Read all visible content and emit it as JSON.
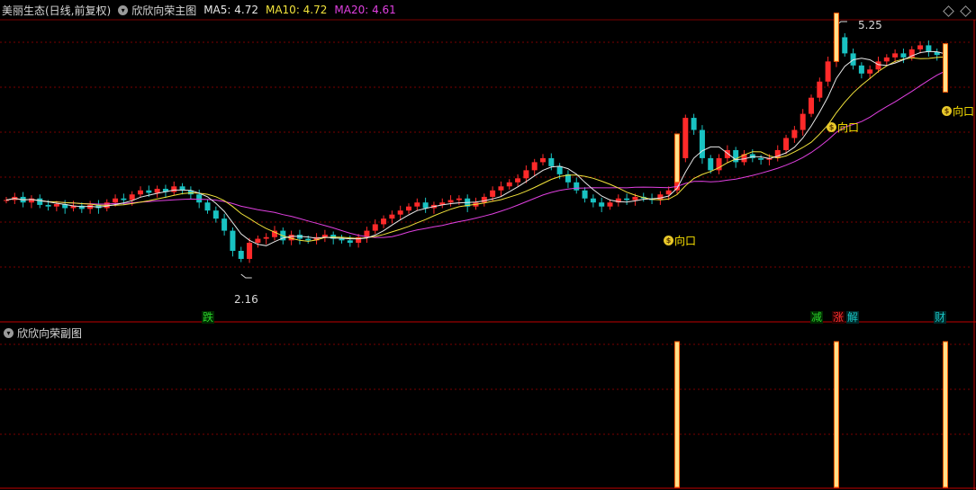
{
  "header": {
    "stock_title": "美丽生态(日线,前复权)",
    "indicator_name": "欣欣向荣主图",
    "ma5_label": "MA5: 4.72",
    "ma10_label": "MA10: 4.72",
    "ma20_label": "MA20: 4.61"
  },
  "sub_panel": {
    "title": "欣欣向荣副图"
  },
  "annotations": {
    "high_label": "5.25",
    "low_label": "2.16"
  },
  "signals": [
    "跌",
    "减",
    "涨",
    "解",
    "财"
  ],
  "money_label": "向口",
  "colors": {
    "up": "#ff2a2a",
    "down": "#19c2c2",
    "ma5": "#e8e8e8",
    "ma10": "#f2e33b",
    "ma20": "#e040e0",
    "grid": "#7a0000",
    "signal_bar": "#ffe08a"
  },
  "chart_data": {
    "type": "candlestick",
    "title": "欣欣向荣主图",
    "price_high": 5.25,
    "price_low": 2.16,
    "ma_latest": {
      "MA5": 4.72,
      "MA10": 4.72,
      "MA20": 4.61
    },
    "closes": [
      3.08,
      3.12,
      3.05,
      3.1,
      3.02,
      3.0,
      3.03,
      2.98,
      3.01,
      2.97,
      3.02,
      2.98,
      3.05,
      3.1,
      3.08,
      3.15,
      3.2,
      3.17,
      3.22,
      3.18,
      3.25,
      3.2,
      3.15,
      3.05,
      2.95,
      2.85,
      2.7,
      2.45,
      2.35,
      2.55,
      2.6,
      2.62,
      2.7,
      2.58,
      2.65,
      2.6,
      2.58,
      2.62,
      2.65,
      2.6,
      2.58,
      2.55,
      2.62,
      2.7,
      2.78,
      2.85,
      2.9,
      2.95,
      3.0,
      3.05,
      2.98,
      3.02,
      3.05,
      3.08,
      3.1,
      3.0,
      3.05,
      3.12,
      3.2,
      3.25,
      3.3,
      3.35,
      3.45,
      3.55,
      3.6,
      3.5,
      3.4,
      3.3,
      3.2,
      3.1,
      3.05,
      3.0,
      3.05,
      3.1,
      3.08,
      3.12,
      3.1,
      3.08,
      3.15,
      3.2,
      3.6,
      4.1,
      3.95,
      3.6,
      3.45,
      3.6,
      3.7,
      3.55,
      3.65,
      3.6,
      3.58,
      3.6,
      3.7,
      3.85,
      3.95,
      4.15,
      4.35,
      4.55,
      4.8,
      5.1,
      4.9,
      4.75,
      4.65,
      4.7,
      4.8,
      4.85,
      4.9,
      4.85,
      4.95,
      5.0,
      4.92,
      4.88,
      4.72
    ]
  },
  "sub_chart": {
    "type": "signal-bars",
    "signal_bar_count": 3
  }
}
